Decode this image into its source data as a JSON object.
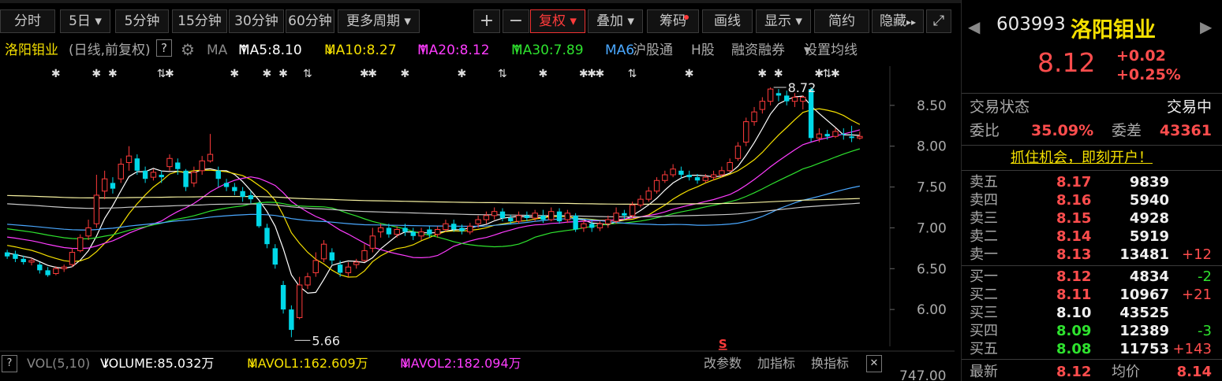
{
  "toolbar": {
    "buttons": [
      "分时",
      "5日",
      "5分钟",
      "15分钟",
      "30分钟",
      "60分钟",
      "更多周期"
    ],
    "plus": "+",
    "minus": "−",
    "fuquan": "复权",
    "overlay": "叠加",
    "chips": "筹码",
    "draw": "画线",
    "display": "显示",
    "simple": "简约",
    "hide": "隐藏",
    "dropdown_glyph": "▾",
    "more_glyph": "▸▸",
    "expand_glyph": "⤢"
  },
  "infoline": {
    "name": "洛阳钼业",
    "mode": "(日线,前复权)",
    "help": "?",
    "ma_label": "MA",
    "ma5": "MA5:8.10",
    "ma10": "MA10:8.27",
    "ma20": "MA20:8.12",
    "ma30": "MA30:7.89",
    "ma_cut": "MA6",
    "up_arrow": "↑",
    "down_arrow": "↓",
    "hk_connect": "沪股通",
    "h_share": "H股",
    "margin": "融资融券",
    "set_ma": "设置均线"
  },
  "colors": {
    "up": "#ff3b3b",
    "down": "#00d8e8",
    "ma5": "#ffffff",
    "ma10": "#f5e000",
    "ma20": "#ff3cff",
    "ma30": "#2ee22e",
    "ma60": "#4aa8ff",
    "ma120": "#c8c8c8",
    "ma250": "#f5f0a0"
  },
  "chart_data": {
    "type": "candlestick",
    "y_ticks": [
      8.5,
      8.0,
      7.5,
      7.0,
      6.5,
      6.0
    ],
    "y_tick_labels": [
      "8.50",
      "8.00",
      "7.50",
      "7.00",
      "6.50",
      "6.00"
    ],
    "ylim": [
      5.5,
      9.0
    ],
    "vol_tick_label": "747.00",
    "high_label": "8.72",
    "low_label": "5.66",
    "s_marker": "S",
    "candles": [
      [
        6.7,
        6.65,
        6.73,
        6.62
      ],
      [
        6.68,
        6.62,
        6.72,
        6.58
      ],
      [
        6.62,
        6.58,
        6.66,
        6.55
      ],
      [
        6.58,
        6.6,
        6.63,
        6.54
      ],
      [
        6.55,
        6.48,
        6.58,
        6.44
      ],
      [
        6.48,
        6.42,
        6.52,
        6.4
      ],
      [
        6.44,
        6.5,
        6.53,
        6.42
      ],
      [
        6.5,
        6.52,
        6.55,
        6.46
      ],
      [
        6.55,
        6.7,
        6.75,
        6.52
      ],
      [
        6.72,
        6.88,
        6.92,
        6.7
      ],
      [
        6.9,
        7.0,
        7.1,
        6.85
      ],
      [
        7.05,
        7.4,
        7.65,
        7.0
      ],
      [
        7.45,
        7.6,
        7.7,
        7.35
      ],
      [
        7.55,
        7.48,
        7.62,
        7.42
      ],
      [
        7.6,
        7.78,
        7.85,
        7.55
      ],
      [
        7.8,
        7.88,
        8.0,
        7.7
      ],
      [
        7.85,
        7.7,
        7.9,
        7.65
      ],
      [
        7.7,
        7.6,
        7.75,
        7.55
      ],
      [
        7.62,
        7.68,
        7.72,
        7.58
      ],
      [
        7.65,
        7.62,
        7.7,
        7.55
      ],
      [
        7.75,
        7.85,
        7.9,
        7.7
      ],
      [
        7.8,
        7.72,
        7.85,
        7.65
      ],
      [
        7.7,
        7.5,
        7.72,
        7.45
      ],
      [
        7.55,
        7.68,
        7.75,
        7.5
      ],
      [
        7.7,
        7.82,
        7.88,
        7.65
      ],
      [
        7.82,
        7.9,
        8.15,
        7.8
      ],
      [
        7.7,
        7.6,
        7.75,
        7.5
      ],
      [
        7.55,
        7.5,
        7.6,
        7.45
      ],
      [
        7.5,
        7.45,
        7.55,
        7.4
      ],
      [
        7.45,
        7.38,
        7.5,
        7.32
      ],
      [
        7.4,
        7.35,
        7.45,
        7.3
      ],
      [
        7.3,
        7.02,
        7.32,
        7.0
      ],
      [
        7.0,
        6.8,
        7.05,
        6.75
      ],
      [
        6.75,
        6.55,
        6.8,
        6.5
      ],
      [
        6.3,
        6.0,
        6.35,
        5.95
      ],
      [
        6.0,
        5.75,
        6.05,
        5.66
      ],
      [
        5.9,
        6.3,
        6.4,
        5.88
      ],
      [
        6.3,
        6.4,
        6.45,
        6.25
      ],
      [
        6.45,
        6.6,
        6.7,
        6.4
      ],
      [
        6.62,
        6.8,
        6.85,
        6.58
      ],
      [
        6.7,
        6.6,
        6.75,
        6.55
      ],
      [
        6.55,
        6.45,
        6.6,
        6.4
      ],
      [
        6.45,
        6.52,
        6.58,
        6.4
      ],
      [
        6.55,
        6.58,
        6.62,
        6.5
      ],
      [
        6.6,
        6.72,
        6.8,
        6.58
      ],
      [
        6.75,
        6.9,
        7.0,
        6.7
      ],
      [
        6.95,
        7.0,
        7.05,
        6.88
      ],
      [
        7.0,
        6.92,
        7.05,
        6.88
      ],
      [
        6.92,
        6.98,
        7.02,
        6.88
      ],
      [
        7.0,
        6.95,
        7.05,
        6.9
      ],
      [
        6.95,
        6.9,
        7.0,
        6.85
      ],
      [
        6.9,
        6.95,
        7.0,
        6.85
      ],
      [
        6.98,
        6.92,
        7.02,
        6.88
      ],
      [
        6.92,
        6.98,
        7.02,
        6.88
      ],
      [
        6.98,
        7.05,
        7.1,
        6.95
      ],
      [
        7.05,
        6.98,
        7.1,
        6.95
      ],
      [
        7.0,
        6.96,
        7.04,
        6.92
      ],
      [
        6.95,
        7.02,
        7.06,
        6.92
      ],
      [
        7.05,
        7.1,
        7.15,
        7.0
      ],
      [
        7.1,
        7.15,
        7.2,
        7.05
      ],
      [
        7.15,
        7.2,
        7.25,
        7.1
      ],
      [
        7.2,
        7.12,
        7.24,
        7.08
      ],
      [
        7.12,
        7.08,
        7.16,
        7.04
      ],
      [
        7.08,
        7.15,
        7.2,
        7.05
      ],
      [
        7.15,
        7.12,
        7.2,
        7.08
      ],
      [
        7.12,
        7.18,
        7.22,
        7.08
      ],
      [
        7.15,
        7.1,
        7.22,
        7.06
      ],
      [
        7.1,
        7.2,
        7.25,
        7.08
      ],
      [
        7.2,
        7.08,
        7.24,
        7.05
      ],
      [
        7.1,
        7.18,
        7.22,
        7.06
      ],
      [
        7.15,
        6.98,
        7.18,
        6.95
      ],
      [
        7.0,
        7.05,
        7.1,
        6.95
      ],
      [
        7.05,
        7.0,
        7.1,
        6.95
      ],
      [
        7.0,
        7.05,
        7.08,
        6.96
      ],
      [
        7.05,
        7.1,
        7.15,
        7.0
      ],
      [
        7.08,
        7.18,
        7.25,
        7.05
      ],
      [
        7.18,
        7.15,
        7.22,
        7.1
      ],
      [
        7.15,
        7.28,
        7.32,
        7.12
      ],
      [
        7.28,
        7.35,
        7.4,
        7.25
      ],
      [
        7.35,
        7.45,
        7.5,
        7.32
      ],
      [
        7.45,
        7.58,
        7.62,
        7.42
      ],
      [
        7.58,
        7.65,
        7.7,
        7.55
      ],
      [
        7.65,
        7.72,
        7.78,
        7.62
      ],
      [
        7.7,
        7.65,
        7.75,
        7.6
      ],
      [
        7.65,
        7.62,
        7.7,
        7.58
      ],
      [
        7.62,
        7.58,
        7.66,
        7.54
      ],
      [
        7.58,
        7.62,
        7.66,
        7.55
      ],
      [
        7.62,
        7.65,
        7.7,
        7.58
      ],
      [
        7.65,
        7.7,
        7.75,
        7.62
      ],
      [
        7.7,
        7.8,
        7.85,
        7.68
      ],
      [
        7.85,
        8.0,
        8.05,
        7.82
      ],
      [
        8.05,
        8.3,
        8.35,
        8.0
      ],
      [
        8.3,
        8.42,
        8.48,
        8.25
      ],
      [
        8.45,
        8.55,
        8.6,
        8.4
      ],
      [
        8.55,
        8.7,
        8.72,
        8.5
      ],
      [
        8.65,
        8.62,
        8.7,
        8.55
      ],
      [
        8.62,
        8.55,
        8.68,
        8.5
      ],
      [
        8.55,
        8.6,
        8.65,
        8.48
      ],
      [
        8.55,
        8.6,
        8.62,
        8.45
      ],
      [
        8.7,
        8.1,
        8.72,
        8.05
      ],
      [
        8.1,
        8.15,
        8.22,
        8.05
      ],
      [
        8.15,
        8.12,
        8.2,
        8.08
      ],
      [
        8.12,
        8.18,
        8.22,
        8.1
      ],
      [
        8.15,
        8.14,
        8.22,
        8.08
      ],
      [
        8.12,
        8.1,
        8.25,
        8.05
      ],
      [
        8.1,
        8.12,
        8.18,
        8.08
      ]
    ]
  },
  "volline": {
    "help": "?",
    "vol_label": "VOL(5,10)",
    "volume": "VOLUME:85.032万",
    "mavol1": "MAVOL1:162.609万",
    "mavol2": "MAVOL2:182.094万",
    "down_arrow": "↓",
    "modify": "改参数",
    "add_ind": "加指标",
    "swap_ind": "换指标",
    "close": "✕"
  },
  "quote": {
    "code": "603993",
    "name": "洛阳钼业",
    "price": "8.12",
    "change": "+0.02",
    "change_pct": "+0.25%",
    "prev_glyph": "◀",
    "next_glyph": "▶",
    "trade_status_label": "交易状态",
    "trade_status": "交易中",
    "weibi_label": "委比",
    "weibi": "35.09%",
    "weicha_label": "委差",
    "weicha": "43361",
    "promo": "抓住机会，即刻开户！",
    "asks": [
      {
        "label": "卖五",
        "price": "8.17",
        "vol": "9839",
        "chg": ""
      },
      {
        "label": "卖四",
        "price": "8.16",
        "vol": "5940",
        "chg": ""
      },
      {
        "label": "卖三",
        "price": "8.15",
        "vol": "4928",
        "chg": ""
      },
      {
        "label": "卖二",
        "price": "8.14",
        "vol": "5919",
        "chg": ""
      },
      {
        "label": "卖一",
        "price": "8.13",
        "vol": "13481",
        "chg": "+12"
      }
    ],
    "bids": [
      {
        "label": "买一",
        "price": "8.12",
        "vol": "4834",
        "chg": "-2"
      },
      {
        "label": "买二",
        "price": "8.11",
        "vol": "10967",
        "chg": "+21"
      },
      {
        "label": "买三",
        "price": "8.10",
        "vol": "43525",
        "chg": ""
      },
      {
        "label": "买四",
        "price": "8.09",
        "vol": "12389",
        "chg": "-3"
      },
      {
        "label": "买五",
        "price": "8.08",
        "vol": "11753",
        "chg": "+143"
      }
    ],
    "latest_label": "最新",
    "latest": "8.12",
    "avg_label": "均价",
    "avg": "8.14"
  }
}
